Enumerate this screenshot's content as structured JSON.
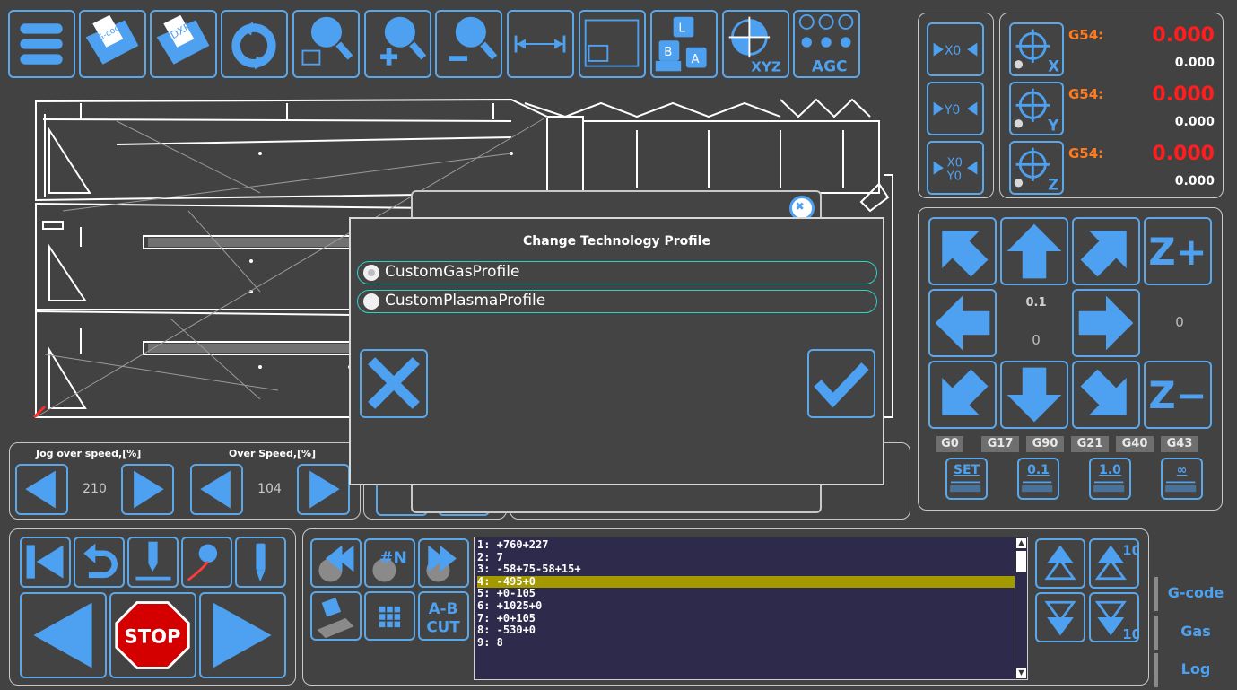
{
  "jog": {
    "label": "Jog over speed,[%]",
    "value": "210"
  },
  "overspeed": {
    "label": "Over Speed,[%]",
    "value": "104"
  },
  "coords": [
    {
      "label": "G54:",
      "value": "0.000",
      "machine": "0.000",
      "axis": "X",
      "reset": "X0"
    },
    {
      "label": "G54:",
      "value": "0.000",
      "machine": "0.000",
      "axis": "Y",
      "reset": "Y0"
    },
    {
      "label": "G54:",
      "value": "0.000",
      "machine": "0.000",
      "axis": "Z",
      "reset": "X0\nY0"
    }
  ],
  "jogpad": {
    "step_value": "0.1",
    "xy_value": "0",
    "z_value": "0",
    "z_plus": "Z+",
    "z_minus": "Z−"
  },
  "gcodes": [
    "G0",
    "G17",
    "G90",
    "G21",
    "G40",
    "G43"
  ],
  "step_buttons": [
    "SET",
    "0.1",
    "1.0",
    "∞"
  ],
  "toolbar": {
    "gcode_label": "G-code",
    "dxf_label": "DXF",
    "xyz_label": "XYZ",
    "agc_label": "AGC",
    "ab_label_1": "A-B",
    "ab_label_2": "CUT",
    "n_label": "#N"
  },
  "dialog": {
    "title": "Change Technology Profile",
    "options": [
      "CustomGasProfile",
      "CustomPlasmaProfile"
    ],
    "selected": 0
  },
  "stop_label": "STOP",
  "program_lines": [
    "1: +760+227",
    "2: 7",
    "3: -58+75-58+15+",
    "4: -495+0",
    "5: +0-105",
    "6: +1025+0",
    "7: +0+105",
    "8: -530+0",
    "9: 8"
  ],
  "highlighted_line": 3,
  "scroll_buttons": {
    "up10": "10",
    "down10": "10"
  },
  "side_tabs": [
    "G-code",
    "Gas",
    "Log"
  ],
  "colors": {
    "accent": "#5ba7e8",
    "button_fill": "#4ea1f0",
    "coord_red": "#ff1e1e",
    "coord_orange": "#ff7b1c",
    "highlight": "#a39a00",
    "teal": "#2fd3c4"
  }
}
